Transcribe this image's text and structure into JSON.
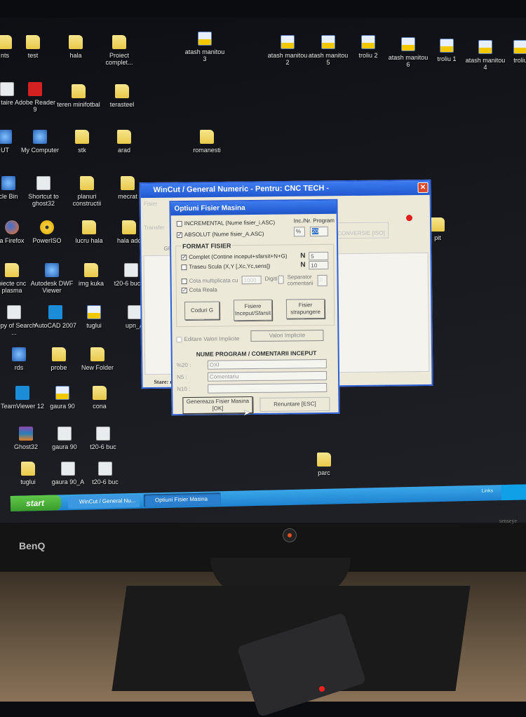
{
  "desktop_icons": [
    {
      "label": "nts",
      "type": "folder"
    },
    {
      "label": "test",
      "type": "folder"
    },
    {
      "label": "hala",
      "type": "folder"
    },
    {
      "label": "Proiect complet...",
      "type": "folder"
    },
    {
      "label": "atash manitou 3",
      "type": "dwg"
    },
    {
      "label": "atash manitou 2",
      "type": "dwg"
    },
    {
      "label": "atash manitou 5",
      "type": "dwg"
    },
    {
      "label": "troliu 2",
      "type": "dwg"
    },
    {
      "label": "atash manitou 6",
      "type": "dwg"
    },
    {
      "label": "troliu 1",
      "type": "dwg"
    },
    {
      "label": "atash manitou 4",
      "type": "dwg"
    },
    {
      "label": "troliu",
      "type": "dwg"
    },
    {
      "label": "taire",
      "type": "doc"
    },
    {
      "label": "Adobe Reader 9",
      "type": "pdf"
    },
    {
      "label": "teren minifotbal",
      "type": "folder"
    },
    {
      "label": "terasteel",
      "type": "folder"
    },
    {
      "label": "UT",
      "type": "app"
    },
    {
      "label": "My Computer",
      "type": "app"
    },
    {
      "label": "stk",
      "type": "folder"
    },
    {
      "label": "arad",
      "type": "folder"
    },
    {
      "label": "romanesti",
      "type": "folder"
    },
    {
      "label": "cle Bin",
      "type": "app"
    },
    {
      "label": "Shortcut to ghost32",
      "type": "doc"
    },
    {
      "label": "planuri constructii",
      "type": "folder"
    },
    {
      "label": "mecrat",
      "type": "folder"
    },
    {
      "label": "a Firefox",
      "type": "fox"
    },
    {
      "label": "PowerISO",
      "type": "cd"
    },
    {
      "label": "lucru hala",
      "type": "folder"
    },
    {
      "label": "hala adc",
      "type": "folder"
    },
    {
      "label": "oiecte cnc plasma",
      "type": "folder"
    },
    {
      "label": "Autodesk DWF Viewer",
      "type": "app"
    },
    {
      "label": "img kuka",
      "type": "folder"
    },
    {
      "label": "t20-6 buc_A",
      "type": "doc"
    },
    {
      "label": "Copy of Search ...",
      "type": "doc"
    },
    {
      "label": "AutoCAD 2007",
      "type": "tv"
    },
    {
      "label": "tuglui",
      "type": "dwg"
    },
    {
      "label": "upn_A",
      "type": "doc"
    },
    {
      "label": "rds",
      "type": "app"
    },
    {
      "label": "probe",
      "type": "folder"
    },
    {
      "label": "New Folder",
      "type": "folder"
    },
    {
      "label": "TeamViewer 12",
      "type": "tv"
    },
    {
      "label": "gaura 90",
      "type": "dwg"
    },
    {
      "label": "cona",
      "type": "folder"
    },
    {
      "label": "Ghost32",
      "type": "rar"
    },
    {
      "label": "gaura 90",
      "type": "doc"
    },
    {
      "label": "t20-6 buc",
      "type": "doc"
    },
    {
      "label": "tuglui",
      "type": "folder"
    },
    {
      "label": "gaura 90_A",
      "type": "doc"
    },
    {
      "label": "t20-6 buc",
      "type": "doc"
    },
    {
      "label": "pit",
      "type": "folder"
    },
    {
      "label": "parc",
      "type": "folder"
    }
  ],
  "wincut": {
    "title": "WinCut / General Numeric  -  Pentru: CNC TECH -",
    "menu": "Fisier",
    "transfer": "Transfer",
    "conversie": "CONVERSIE [ISO]",
    "gra": "GRA",
    "status": "Stare: ne"
  },
  "dialog": {
    "title": "Optiuni Fisier Masina",
    "incremental": "INCREMENTAL (Nume fisier_i.ASC)",
    "incremental_checked": false,
    "absolut": "ABSOLUT (Nume fisier_A.ASC)",
    "absolut_checked": true,
    "inc_label": "Inc./Nr. Program",
    "inc_prefix": "%",
    "inc_value": "20",
    "format_header": "FORMAT FISIER",
    "complet": "Complet (Contine inceput+sfarsit+N+G)",
    "complet_checked": true,
    "n1_label": "N",
    "n1_value": "5",
    "traseu": "Traseu Scula (X,Y [,Xc,Yc,sens])",
    "traseu_checked": false,
    "n2_label": "N",
    "n2_value": "10",
    "cota_mult": "Cota multiplicata cu",
    "cota_mult_value": "1000",
    "digiti": "Digiti",
    "separator": "Separator comentarii",
    "separator_value": "::",
    "cota_reala": "Cota Reala",
    "cota_reala_checked": true,
    "btn_coduri": "Coduri G",
    "btn_fisiere": "Fisiere Inceput/Sfarsit",
    "btn_strapungere": "Fisier strapungere",
    "editare": "Editare Valori Implicite",
    "btn_valori": "Valori Implicite",
    "nume_header": "NUME PROGRAM / COMENTARII INCEPUT",
    "row1_label": "%20 :",
    "row1_value": "OXI",
    "row2_label": "N5 :",
    "row2_value": "Comentariu",
    "row3_label": "N10 :",
    "row3_value": "",
    "btn_ok": "Genereaza Fisier Masina [OK]",
    "btn_cancel": "Renuntare [ESC]"
  },
  "taskbar": {
    "start": "start",
    "tasks": [
      "WinCut / General Nu...",
      "Optiuni Fisier Masina"
    ],
    "links": "Links"
  },
  "monitor": {
    "brand": "BenQ",
    "feature": "senseye"
  },
  "colors": {
    "xp_blue": "#2d5fd8",
    "taskbar": "#1f83d0",
    "start_green": "#3a9b2a"
  }
}
